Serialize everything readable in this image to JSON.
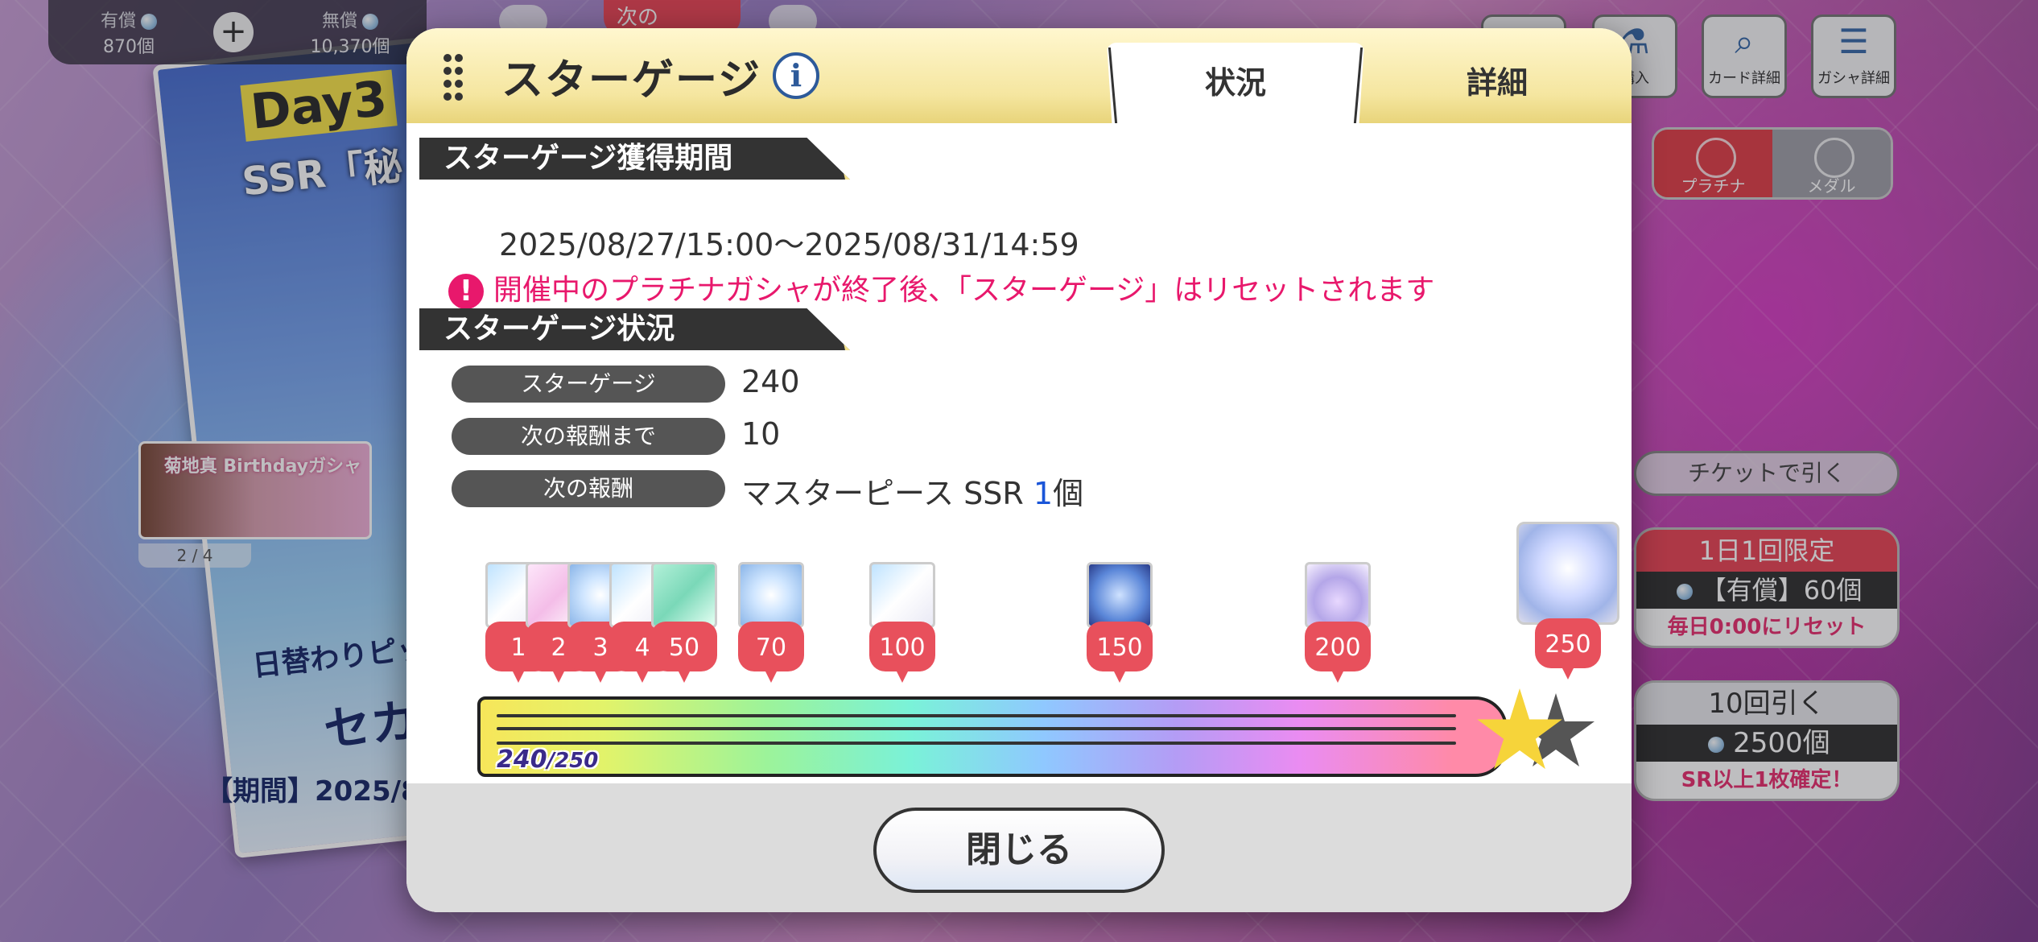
{
  "currency": {
    "paid_label": "有償",
    "paid_value": "870個",
    "free_label": "無償",
    "free_value": "10,370個"
  },
  "left_banner": {
    "day_text": "Day3",
    "ssr_text": "SSR「秘",
    "mid_text": "日替わりピックア",
    "big_text": "セカ",
    "period": "【期間】2025/8",
    "thumb_label": "菊地真 Birthdayガシャ",
    "pager": "2 / 4"
  },
  "top_pill": {
    "label": "次の"
  },
  "toolbar": {
    "purchase": "購入",
    "card_detail": "カード詳細",
    "gacha_detail": "ガシャ詳細"
  },
  "segment": {
    "platinum": "プラチナ",
    "medal": "メダル"
  },
  "side_buttons": {
    "ticket": "チケットで引く",
    "daily_title": "1日1回限定",
    "daily_cost": "【有償】60個",
    "daily_note": "毎日0:00にリセット",
    "ten_title": "10回引く",
    "ten_cost": "2500個",
    "ten_note": "SR以上1枚確定！"
  },
  "dialog": {
    "title": "スターゲージ",
    "tabs": {
      "status": "状況",
      "detail": "詳細"
    },
    "section_period": "スターゲージ獲得期間",
    "period": "2025/08/27/15:00〜2025/08/31/14:59",
    "warning": "開催中のプラチナガシャが終了後、「スターゲージ」はリセットされます",
    "section_status": "スターゲージ状況",
    "rows": [
      {
        "key": "スターゲージ",
        "value": "240"
      },
      {
        "key": "次の報酬まで",
        "value": "10"
      },
      {
        "key": "次の報酬",
        "value_prefix": "マスターピース SSR ",
        "value_count": "1",
        "value_suffix": "個"
      }
    ],
    "milestones": [
      "1",
      "2",
      "3",
      "4",
      "50",
      "70",
      "100",
      "150",
      "200",
      "250"
    ],
    "gauge": {
      "current": "240",
      "max": "/250",
      "fraction": 0.96
    },
    "close_label": "閉じる"
  }
}
